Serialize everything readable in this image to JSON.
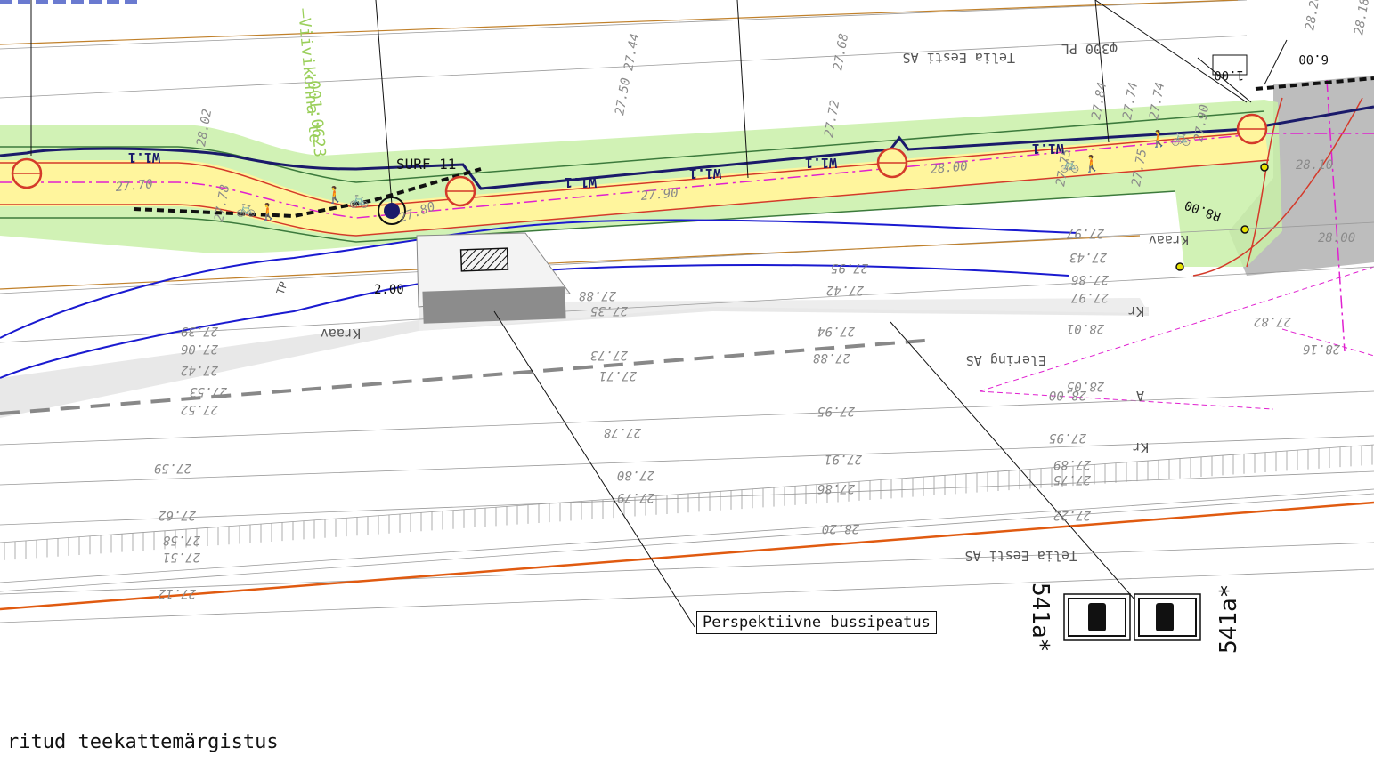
{
  "drawing": {
    "legend_text": "ritud teekattemärgistus",
    "callout_bus_stop": "Perspektiivne bussipeatus",
    "surf_label": "SURF 11",
    "sign_code_left": "541a*",
    "sign_code_right": "541a*",
    "markings": [
      "W1.1",
      "W1.1",
      "W1.1",
      "W1.1",
      "W1.1"
    ],
    "dims": {
      "d200": "2.00",
      "d100": "1.00",
      "d600": "6.00",
      "r800": "R8.00"
    },
    "utilities": {
      "telia1": "Telia Eesti AS",
      "telia2": "Telia Eesti AS",
      "elering": "Elering AS",
      "pipe": "φ300 PL",
      "kraav1": "Kraav",
      "kraav2": "Kraav",
      "kraav3": "Kraav",
      "kr1": "Kr",
      "kr2": "Kr",
      "parcel": "—Viivikonna te",
      "parcel_id": ":001:0623",
      "letter_a": "A",
      "tp": "TP"
    },
    "elevations": [
      "27.70",
      "27.90",
      "28.00",
      "28.10",
      "28.00",
      "27.80",
      "27.44",
      "27.50",
      "27.68",
      "27.72",
      "27.97",
      "27.43",
      "27.95",
      "27.86",
      "27.97",
      "27.42",
      "27.88",
      "27.35",
      "27.94",
      "28.01",
      "27.39",
      "27.06",
      "27.73",
      "27.42",
      "27.88",
      "27.71",
      "27.53",
      "27.52",
      "28.05",
      "27.95",
      "27.59",
      "27.78",
      "27.95",
      "27.91",
      "27.80",
      "27.89",
      "27.75",
      "27.79",
      "27.86",
      "27.62",
      "27.58",
      "27.51",
      "27.12",
      "28.20",
      "27.22",
      "27.82",
      "28.16",
      "28.00",
      "28.26",
      "28.18",
      "27.90",
      "27.84",
      "27.74",
      "27.75",
      "27.74",
      "27.75",
      "27.78",
      "28.02"
    ]
  }
}
